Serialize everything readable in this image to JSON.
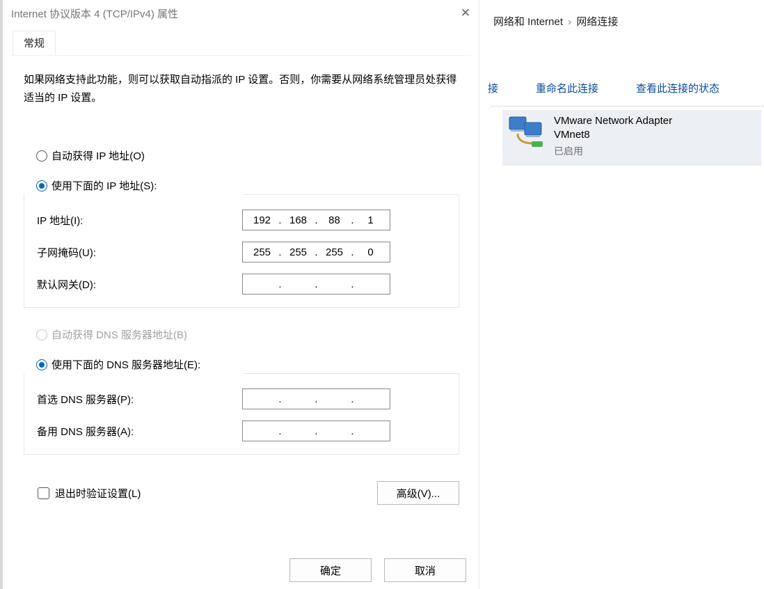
{
  "bg": {
    "breadcrumb": {
      "a": "网络和 Internet",
      "b": "网络连接"
    },
    "links": {
      "a": "接",
      "rename": "重命名此连接",
      "status": "查看此连接的状态"
    },
    "adapter": {
      "title1": "VMware Network Adapter",
      "title2": "VMnet8",
      "status": "已启用"
    }
  },
  "dialog": {
    "title": "Internet 协议版本 4 (TCP/IPv4) 属性",
    "tab": "常规",
    "desc": "如果网络支持此功能，则可以获取自动指派的 IP 设置。否则，你需要从网络系统管理员处获得适当的 IP 设置。",
    "radio_auto_ip": "自动获得 IP 地址(O)",
    "radio_use_ip": "使用下面的 IP 地址(S):",
    "ip_label": "IP 地址(I):",
    "ip_value": [
      "192",
      "168",
      "88",
      "1"
    ],
    "mask_label": "子网掩码(U):",
    "mask_value": [
      "255",
      "255",
      "255",
      "0"
    ],
    "gw_label": "默认网关(D):",
    "gw_value": [
      "",
      "",
      "",
      ""
    ],
    "radio_auto_dns": "自动获得 DNS 服务器地址(B)",
    "radio_use_dns": "使用下面的 DNS 服务器地址(E):",
    "dns1_label": "首选 DNS 服务器(P):",
    "dns1_value": [
      "",
      "",
      "",
      ""
    ],
    "dns2_label": "备用 DNS 服务器(A):",
    "dns2_value": [
      "",
      "",
      "",
      ""
    ],
    "chk_validate": "退出时验证设置(L)",
    "btn_advanced": "高级(V)...",
    "btn_ok": "确定",
    "btn_cancel": "取消"
  }
}
